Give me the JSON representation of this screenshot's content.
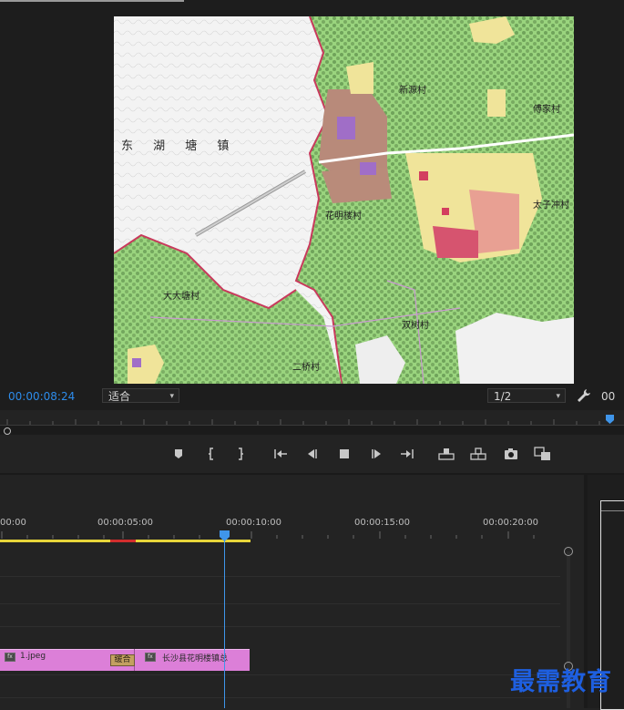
{
  "monitor": {
    "timecode": "00:00:08:24",
    "fit_select": "适合",
    "resolution_select": "1/2",
    "timecode_right": "00",
    "map": {
      "region_label": "东 湖 塘 镇",
      "village_labels": [
        "新源村",
        "傅家村",
        "花明楼村",
        "太子冲村",
        "大大塘村",
        "双树村",
        "二桥村"
      ]
    }
  },
  "transport": {
    "buttons": [
      "marker-icon",
      "in-point-icon",
      "out-point-icon",
      "go-to-in-icon",
      "step-back-icon",
      "stop-icon",
      "step-forward-icon",
      "go-to-out-icon",
      "lift-icon",
      "extract-icon",
      "export-frame-icon",
      "button-editor-icon"
    ]
  },
  "timeline": {
    "ruler_labels": [
      "00:00",
      "00:00:05:00",
      "00:00:10:00",
      "00:00:15:00",
      "00:00:20:00"
    ],
    "clip1_name": "1.jpeg",
    "transition_label": "缓合",
    "clip2_name": "长沙县花明楼镇总"
  },
  "watermark": "最需教育",
  "colors": {
    "timecode": "#2d8ceb",
    "playhead": "#3f95ea",
    "clip": "#dc7fd8",
    "work_area": "#e7d53a",
    "render_red": "#d22d2d",
    "watermark": "#1e5fe0"
  }
}
